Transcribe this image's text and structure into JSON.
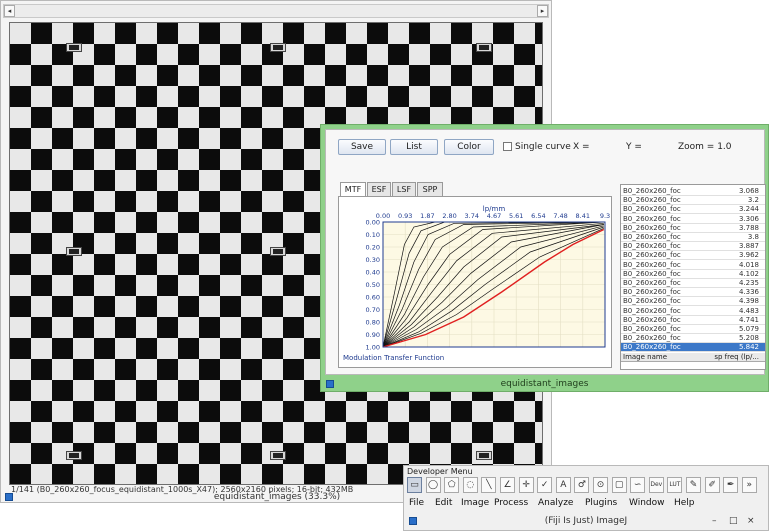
{
  "image_window": {
    "title": "equidistant_images (33.3%)",
    "info": "1/141 (B0_260x260_focus_equidistant_1000s_X47); 2560x2160 pixels; 16-bit; 432MB",
    "scroll_left": "◂",
    "scroll_right": "▸"
  },
  "plot_window": {
    "title": "equidistant_images",
    "buttons": {
      "save": "Save",
      "list": "List",
      "color": "Color"
    },
    "single_curve_label": "Single curve",
    "readouts": {
      "x": "X =",
      "y": "Y =",
      "zoom": "Zoom = 1.0"
    },
    "tabs": [
      "MTF",
      "ESF",
      "LSF",
      "SPP"
    ],
    "plot": {
      "x_axis_title": "lp/mm",
      "y_axis_title": "Modulation Transfer Function"
    },
    "table": {
      "headers": {
        "name": "Image name",
        "value": "sp freq (lp/..."
      },
      "rows": [
        {
          "name": "B0_260x260_foc",
          "value": "3.068"
        },
        {
          "name": "B0_260x260_foc",
          "value": "3.2"
        },
        {
          "name": "B0_260x260_foc",
          "value": "3.244"
        },
        {
          "name": "B0_260x260_foc",
          "value": "3.306"
        },
        {
          "name": "B0_260x260_foc",
          "value": "3.788"
        },
        {
          "name": "B0_260x260_foc",
          "value": "3.8"
        },
        {
          "name": "B0_260x260_foc",
          "value": "3.887"
        },
        {
          "name": "B0_260x260_foc",
          "value": "3.962"
        },
        {
          "name": "B0_260x260_foc",
          "value": "4.018"
        },
        {
          "name": "B0_260x260_foc",
          "value": "4.102"
        },
        {
          "name": "B0_260x260_foc",
          "value": "4.235"
        },
        {
          "name": "B0_260x260_foc",
          "value": "4.336"
        },
        {
          "name": "B0_260x260_foc",
          "value": "4.398"
        },
        {
          "name": "B0_260x260_foc",
          "value": "4.483"
        },
        {
          "name": "B0_260x260_foc",
          "value": "4.741"
        },
        {
          "name": "B0_260x260_foc",
          "value": "5.079"
        },
        {
          "name": "B0_260x260_foc",
          "value": "5.208"
        },
        {
          "name": "B0_260x260_foc",
          "value": "5.842"
        }
      ]
    }
  },
  "chart_data": {
    "type": "line",
    "xlabel": "lp/mm",
    "ylabel": "Modulation Transfer Function",
    "x_ticks": [
      "0.00",
      "0.93",
      "1.87",
      "2.80",
      "3.74",
      "4.67",
      "5.61",
      "6.54",
      "7.48",
      "8.41",
      "9.3"
    ],
    "y_ticks": [
      "0.00",
      "0.10",
      "0.20",
      "0.30",
      "0.40",
      "0.50",
      "0.60",
      "0.70",
      "0.80",
      "0.90",
      "1.00"
    ],
    "xlim": [
      0,
      9.35
    ],
    "ylim": [
      0,
      1
    ],
    "grid": true,
    "background": "#fdf9e4",
    "curve_color": "#111111",
    "highlight_color": "#e02020",
    "axis_color": "#1f3b8f",
    "black_curves": [
      {
        "values": [
          [
            0,
            1
          ],
          [
            0.5,
            0.55
          ],
          [
            0.9,
            0.18
          ],
          [
            1.3,
            0.04
          ],
          [
            2.2,
            0
          ],
          [
            9.3,
            0
          ]
        ]
      },
      {
        "values": [
          [
            0,
            1
          ],
          [
            0.6,
            0.6
          ],
          [
            1.1,
            0.25
          ],
          [
            1.6,
            0.07
          ],
          [
            2.6,
            0
          ],
          [
            9.3,
            0
          ]
        ]
      },
      {
        "values": [
          [
            0,
            1
          ],
          [
            0.7,
            0.66
          ],
          [
            1.3,
            0.32
          ],
          [
            1.9,
            0.1
          ],
          [
            3.0,
            0.01
          ],
          [
            9.3,
            0
          ]
        ]
      },
      {
        "values": [
          [
            0,
            1
          ],
          [
            0.8,
            0.7
          ],
          [
            1.5,
            0.38
          ],
          [
            2.2,
            0.14
          ],
          [
            3.4,
            0.02
          ],
          [
            9.3,
            0
          ]
        ]
      },
      {
        "values": [
          [
            0,
            1
          ],
          [
            0.9,
            0.74
          ],
          [
            1.7,
            0.44
          ],
          [
            2.5,
            0.2
          ],
          [
            3.8,
            0.04
          ],
          [
            9.3,
            0
          ]
        ]
      },
      {
        "values": [
          [
            0,
            1
          ],
          [
            1.0,
            0.77
          ],
          [
            1.9,
            0.5
          ],
          [
            2.8,
            0.26
          ],
          [
            4.2,
            0.06
          ],
          [
            9.3,
            0
          ]
        ]
      },
      {
        "values": [
          [
            0,
            1
          ],
          [
            1.1,
            0.8
          ],
          [
            2.1,
            0.55
          ],
          [
            3.1,
            0.31
          ],
          [
            4.6,
            0.09
          ],
          [
            9.3,
            0.01
          ]
        ]
      },
      {
        "values": [
          [
            0,
            1
          ],
          [
            1.2,
            0.82
          ],
          [
            2.3,
            0.6
          ],
          [
            3.4,
            0.36
          ],
          [
            5.0,
            0.12
          ],
          [
            9.3,
            0.02
          ]
        ]
      },
      {
        "values": [
          [
            0,
            1
          ],
          [
            1.3,
            0.84
          ],
          [
            2.5,
            0.64
          ],
          [
            3.7,
            0.41
          ],
          [
            5.4,
            0.16
          ],
          [
            9.3,
            0.02
          ]
        ]
      },
      {
        "values": [
          [
            0,
            1
          ],
          [
            1.4,
            0.86
          ],
          [
            2.7,
            0.68
          ],
          [
            4.0,
            0.46
          ],
          [
            5.8,
            0.2
          ],
          [
            9.3,
            0.03
          ]
        ]
      },
      {
        "values": [
          [
            0,
            1
          ],
          [
            1.5,
            0.88
          ],
          [
            2.9,
            0.71
          ],
          [
            4.3,
            0.5
          ],
          [
            6.2,
            0.24
          ],
          [
            9.3,
            0.04
          ]
        ]
      },
      {
        "values": [
          [
            0,
            1
          ],
          [
            1.6,
            0.89
          ],
          [
            3.1,
            0.74
          ],
          [
            4.6,
            0.54
          ],
          [
            6.6,
            0.28
          ],
          [
            9.3,
            0.05
          ]
        ]
      }
    ],
    "highlight_curve": {
      "values": [
        [
          0,
          1
        ],
        [
          1.8,
          0.9
        ],
        [
          3.4,
          0.76
        ],
        [
          5.0,
          0.56
        ],
        [
          6.8,
          0.32
        ],
        [
          8.0,
          0.18
        ],
        [
          9.3,
          0.06
        ]
      ]
    }
  },
  "fiji_window": {
    "title": "(Fiji Is Just) ImageJ",
    "developer_menu": "Developer Menu",
    "tools": [
      {
        "glyph": "▭",
        "icon": "rectangle-tool-icon"
      },
      {
        "glyph": "◯",
        "icon": "oval-tool-icon"
      },
      {
        "glyph": "⬠",
        "icon": "polygon-tool-icon"
      },
      {
        "glyph": "◌",
        "icon": "freehand-tool-icon"
      },
      {
        "glyph": "╲",
        "icon": "line-tool-icon"
      },
      {
        "glyph": "∠",
        "icon": "angle-tool-icon"
      },
      {
        "glyph": "✛",
        "icon": "point-tool-icon"
      },
      {
        "glyph": "✓",
        "icon": "wand-tool-icon"
      },
      {
        "glyph": "A",
        "icon": "text-tool-icon"
      },
      {
        "glyph": "♂",
        "icon": "zoom-tool-icon"
      },
      {
        "glyph": "⊙",
        "icon": "hand-tool-icon"
      },
      {
        "glyph": "▢",
        "icon": "color-picker-icon"
      },
      {
        "glyph": "∽",
        "icon": "stack-tools-icon"
      },
      {
        "glyph": "Dev",
        "icon": "developer-icon"
      },
      {
        "glyph": "LUT",
        "icon": "lut-icon"
      },
      {
        "glyph": "✎",
        "icon": "pencil-icon"
      },
      {
        "glyph": "✐",
        "icon": "brush-icon"
      },
      {
        "glyph": "✒",
        "icon": "flood-fill-icon"
      },
      {
        "glyph": "»",
        "icon": "more-tools-icon"
      }
    ],
    "menus": [
      "File",
      "Edit",
      "Image",
      "Process",
      "Analyze",
      "Plugins",
      "Window",
      "Help"
    ],
    "window_controls": {
      "minimize": "–",
      "maximize": "□",
      "close": "×"
    }
  }
}
